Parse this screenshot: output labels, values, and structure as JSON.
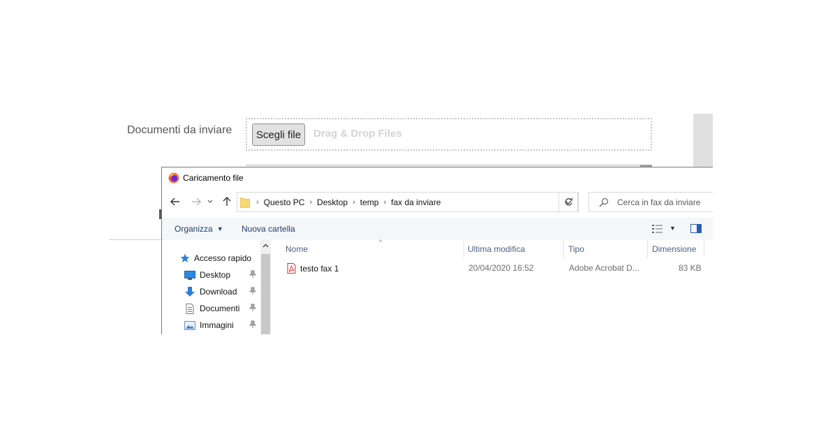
{
  "page": {
    "form_label": "Documenti da inviare",
    "choose_file_label": "Scegli file",
    "dragdrop_text": "Drag & Drop Files"
  },
  "dialog": {
    "title": "Caricamento file",
    "breadcrumb": [
      "Questo PC",
      "Desktop",
      "temp",
      "fax da inviare"
    ],
    "search_placeholder": "Cerca in fax da inviare",
    "toolbar": {
      "organize_label": "Organizza",
      "new_folder_label": "Nuova cartella"
    },
    "nav_items": [
      {
        "label": "Accesso rapido",
        "icon": "star-icon"
      },
      {
        "label": "Desktop",
        "icon": "desktop-icon",
        "pinned": true
      },
      {
        "label": "Download",
        "icon": "download-arrow-icon",
        "pinned": true
      },
      {
        "label": "Documenti",
        "icon": "document-icon",
        "pinned": true
      },
      {
        "label": "Immagini",
        "icon": "image-icon",
        "pinned": true
      }
    ],
    "columns": [
      "Nome",
      "Ultima modifica",
      "Tipo",
      "Dimensione"
    ],
    "files": [
      {
        "name": "testo fax 1",
        "modified": "20/04/2020 16:52",
        "type": "Adobe Acrobat D...",
        "size": "83 KB",
        "icon": "pdf-icon"
      }
    ]
  },
  "colors": {
    "accent_text": "#1e3e6e",
    "column_header_text": "#4d6082",
    "pdf_red": "#d32f2f",
    "folder_yellow": "#f8d775"
  }
}
